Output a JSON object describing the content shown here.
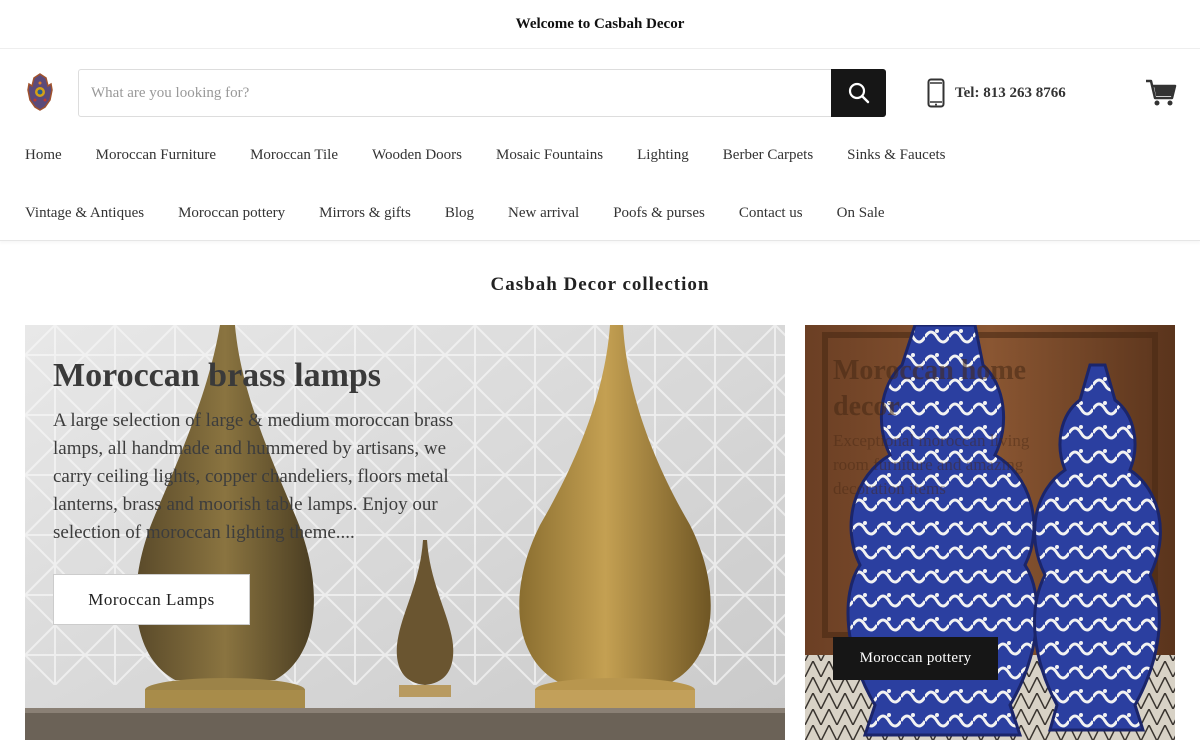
{
  "announcement": {
    "text": "Welcome to Casbah Decor"
  },
  "header": {
    "search": {
      "placeholder": "What are you looking for?",
      "value": ""
    },
    "phone": {
      "text": "Tel: 813 263 8766",
      "icon": "mobile-phone-icon"
    },
    "cart": {
      "icon": "shopping-cart-icon"
    },
    "logo": {
      "icon": "hamsa-hand-icon"
    }
  },
  "nav": {
    "row1": [
      "Home",
      "Moroccan Furniture",
      "Moroccan Tile",
      "Wooden Doors",
      "Mosaic Fountains",
      "Lighting",
      "Berber Carpets",
      "Sinks & Faucets"
    ],
    "row2": [
      "Vintage & Antiques",
      "Moroccan pottery",
      "Mirrors & gifts",
      "Blog",
      "New arrival",
      "Poofs & purses",
      "Contact us",
      "On Sale"
    ]
  },
  "collection": {
    "title": "Casbah Decor collection",
    "cards": [
      {
        "title": "Moroccan brass lamps",
        "description": "A large selection of large & medium moroccan brass lamps, all handmade and hummered by artisans, we carry ceiling lights, copper chandeliers, floors metal lanterns, brass and moorish table lamps. Enjoy our selection of moroccan lighting theme....",
        "button": "Moroccan Lamps"
      },
      {
        "title": "Moroccan home decor",
        "description": "Exceptional moroccan living room furniture and amazing decoration items",
        "button": "Moroccan pottery"
      }
    ]
  },
  "colors": {
    "accent": "#161616",
    "background": "#ffffff",
    "text": "#333333"
  }
}
